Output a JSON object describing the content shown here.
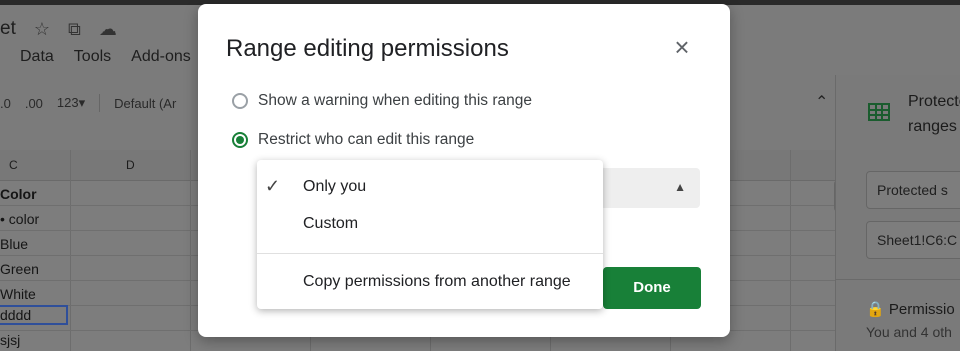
{
  "sheet_title": "et",
  "menubar": [
    "Data",
    "Tools",
    "Add-ons"
  ],
  "toolbar": {
    "dec1": ".0",
    "dec2": ".00",
    "num": "123▾",
    "font": "Default (Ar"
  },
  "columns": {
    "c": "C",
    "d": "D"
  },
  "cells": [
    "Color",
    "• color",
    "Blue",
    "Green",
    "White",
    "dddd",
    "sjsj"
  ],
  "side_panel": {
    "title": "Protected ranges",
    "input1": "Protected s",
    "input2": "Sheet1!C6:C",
    "perm_title": "Permissio",
    "perm_desc": "You and 4 oth"
  },
  "dialog": {
    "title": "Range editing permissions",
    "option1": "Show a warning when editing this range",
    "option2": "Restrict who can edit this range",
    "done_label": "Done",
    "selected_option": "Only you"
  },
  "dropdown": {
    "items": [
      "Only you",
      "Custom",
      "Copy permissions from another range"
    ]
  },
  "colors": {
    "accent": "#188038",
    "overlay": "#7b7b7b"
  }
}
